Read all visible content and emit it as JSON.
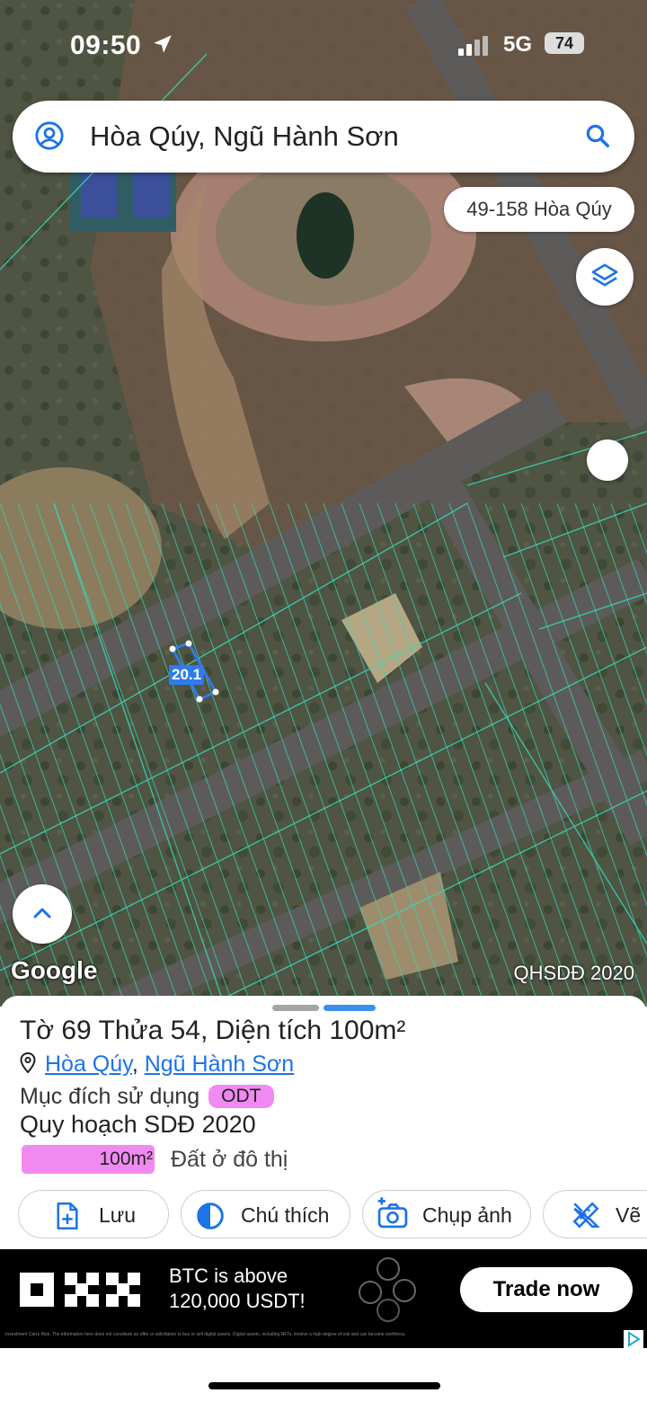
{
  "status": {
    "time": "09:50",
    "network": "5G",
    "battery": "74"
  },
  "search": {
    "query": "Hòa Qúy, Ngũ Hành Sơn"
  },
  "map": {
    "address_chip": "49-158 Hòa Qúy",
    "parcel_label": "20.1",
    "google_logo": "Google",
    "layer_badge": "QHSDĐ 2020",
    "colors": {
      "lines": "#38d4b4",
      "selection": "#2f7bea"
    }
  },
  "sheet": {
    "title": "Tờ 69 Thửa 54, Diện tích 100m²",
    "ward": "Hòa Qúy",
    "separator": ",",
    "district": "Ngũ Hành Sơn",
    "purpose_label": "Mục đích sử dụng",
    "purpose_code": "ODT",
    "plan_title": "Quy hoạch SDĐ 2020",
    "plan_area": "100m²",
    "plan_type": "Đất ở đô thị",
    "actions": [
      {
        "label": "Lưu",
        "icon": "file-add-icon"
      },
      {
        "label": "Chú thích",
        "icon": "contrast-icon"
      },
      {
        "label": "Chụp ảnh",
        "icon": "camera-add-icon"
      },
      {
        "label": "Vẽ",
        "icon": "ruler-pencil-icon"
      }
    ],
    "colors": {
      "accent": "#1d73e8",
      "odt": "#f18af0"
    }
  },
  "ad": {
    "line1": "BTC is above",
    "line2": "120,000 USDT!",
    "cta": "Trade now",
    "fine_print": "Investment Carry Risk. The information here does not constitute an offer or solicitation to buy or sell digital assets. Digital assets, including NFTs, involve a high degree of risk and can become worthless."
  }
}
